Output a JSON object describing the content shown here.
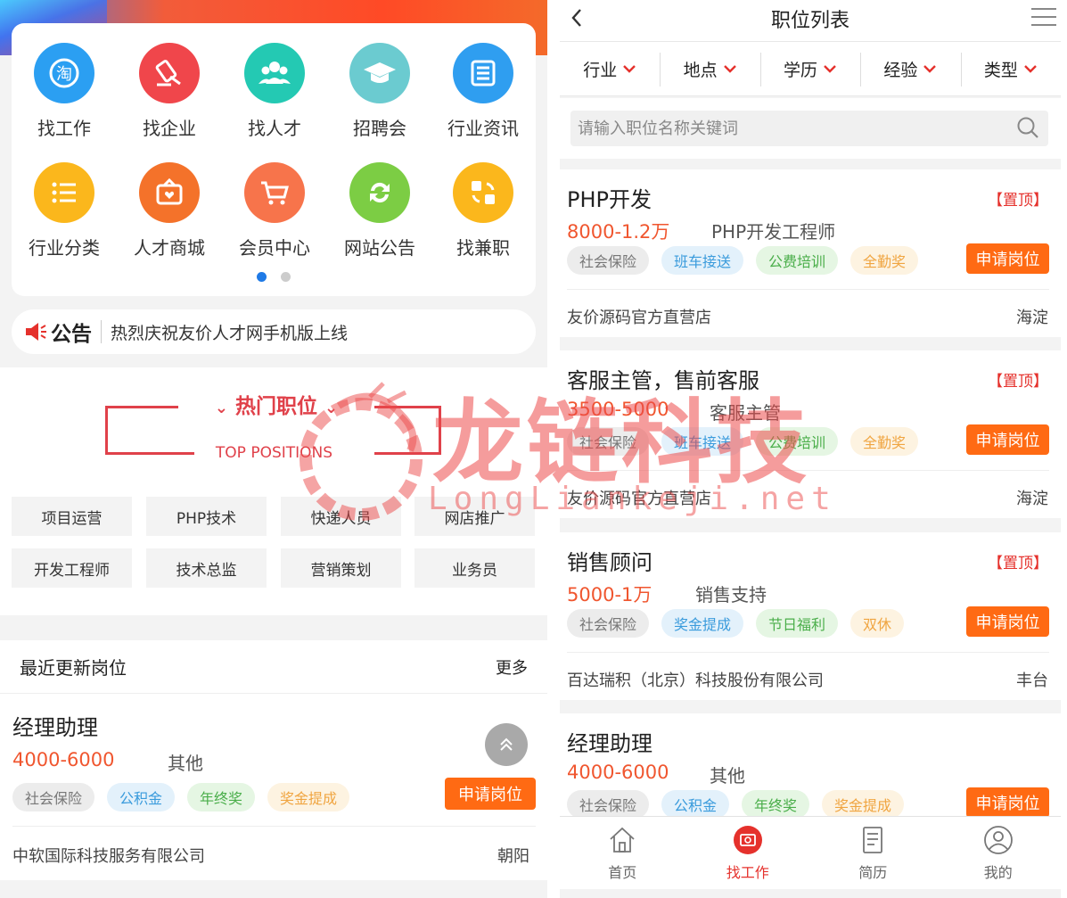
{
  "left": {
    "menu": [
      {
        "label": "找工作",
        "icon": "find-job-icon",
        "color": "#2b9ff2"
      },
      {
        "label": "找企业",
        "icon": "find-company-icon",
        "color": "#f0464b"
      },
      {
        "label": "找人才",
        "icon": "find-talent-icon",
        "color": "#24c9b3"
      },
      {
        "label": "招聘会",
        "icon": "job-fair-icon",
        "color": "#6bcbd0"
      },
      {
        "label": "行业资讯",
        "icon": "industry-news-icon",
        "color": "#2f9ef0"
      },
      {
        "label": "行业分类",
        "icon": "industry-category-icon",
        "color": "#fbb71c"
      },
      {
        "label": "人才商城",
        "icon": "talent-mall-icon",
        "color": "#f4722a"
      },
      {
        "label": "会员中心",
        "icon": "member-center-icon",
        "color": "#f7744b"
      },
      {
        "label": "网站公告",
        "icon": "site-announcement-icon",
        "color": "#7ccd44"
      },
      {
        "label": "找兼职",
        "icon": "part-time-icon",
        "color": "#fbb71c"
      }
    ],
    "notice": {
      "label": "公告",
      "text": "热烈庆祝友价人才网手机版上线"
    },
    "hot": {
      "title": "热门职位",
      "subtitle": "TOP POSITIONS",
      "tags": [
        "项目运营",
        "PHP技术",
        "快递人员",
        "网店推广",
        "开发工程师",
        "技术总监",
        "营销策划",
        "业务员"
      ]
    },
    "recent": {
      "title": "最近更新岗位",
      "more": "更多",
      "job": {
        "title": "经理助理",
        "salary": "4000-6000",
        "category": "其他",
        "tags": [
          "社会保险",
          "公积金",
          "年终奖",
          "奖金提成"
        ],
        "apply": "申请岗位",
        "company": "中软国际科技服务有限公司",
        "area": "朝阳"
      }
    }
  },
  "right": {
    "header": {
      "title": "职位列表"
    },
    "filters": [
      "行业",
      "地点",
      "学历",
      "经验",
      "类型"
    ],
    "search": {
      "placeholder": "请输入职位名称关键词"
    },
    "jobs": [
      {
        "title": "PHP开发",
        "top": "【置顶】",
        "salary": "8000-1.2万",
        "category": "PHP开发工程师",
        "tags": [
          "社会保险",
          "班车接送",
          "公费培训",
          "全勤奖"
        ],
        "apply": "申请岗位",
        "company": "友价源码官方直营店",
        "area": "海淀"
      },
      {
        "title": "客服主管，售前客服",
        "top": "【置顶】",
        "salary": "3500-5000",
        "category": "客服主管",
        "tags": [
          "社会保险",
          "班车接送",
          "公费培训",
          "全勤奖"
        ],
        "apply": "申请岗位",
        "company": "友价源码官方直营店",
        "area": "海淀"
      },
      {
        "title": "销售顾问",
        "top": "【置顶】",
        "salary": "5000-1万",
        "category": "销售支持",
        "tags": [
          "社会保险",
          "奖金提成",
          "节日福利",
          "双休"
        ],
        "apply": "申请岗位",
        "company": "百达瑞积（北京）科技股份有限公司",
        "area": "丰台"
      },
      {
        "title": "经理助理",
        "salary": "4000-6000",
        "category": "其他",
        "tags": [
          "社会保险",
          "公积金",
          "年终奖",
          "奖金提成"
        ],
        "apply": "申请岗位"
      }
    ],
    "tabbar": [
      {
        "label": "首页",
        "icon": "home-icon"
      },
      {
        "label": "找工作",
        "icon": "find-job-tab-icon",
        "active": true
      },
      {
        "label": "简历",
        "icon": "resume-icon"
      },
      {
        "label": "我的",
        "icon": "profile-icon"
      }
    ]
  },
  "watermark": {
    "cn": "龙链科技",
    "en": "LongLiankeji.net"
  },
  "colors": {
    "accent_red": "#e5312c",
    "apply_orange": "#ff6a13",
    "salary_orange": "#f0562f",
    "dot_blue": "#1f7ae6"
  }
}
